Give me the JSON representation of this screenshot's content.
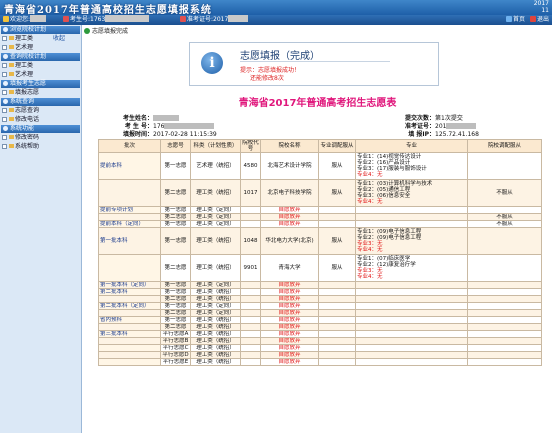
{
  "header": {
    "title": "青海省2017年普通高校招生志愿填报系统",
    "date_line1": "2017",
    "date_line2": "11"
  },
  "topbar": {
    "welcome_label": "欢迎您:",
    "examinee_no_label": "考生号:",
    "examinee_no_value": "1763",
    "admission_no_label": "准考证号:",
    "admission_no_value": "2017",
    "home_label": "首页",
    "exit_label": "退出"
  },
  "sidebar": {
    "groups": [
      {
        "title": "浏览院校计划",
        "items": [
          "理工类",
          "艺术理"
        ],
        "tag": "收起"
      },
      {
        "title": "查询院校计划",
        "items": [
          "理工类",
          "艺术理"
        ]
      },
      {
        "title": "填报考生志愿",
        "items": [
          "填报志愿"
        ]
      },
      {
        "title": "系统查询",
        "items": [
          "志愿查询",
          "修改电话"
        ]
      },
      {
        "title": "系统功能",
        "items": [
          "修改密码",
          "系统帮助"
        ]
      }
    ]
  },
  "breadcrumb": "志愿填报完成",
  "dialog": {
    "title": "志愿填报（完成）",
    "tip_label": "提示：",
    "tip_text": "志愿填报成功！",
    "tip_sub": "还能修改8次",
    "icon": "info-icon"
  },
  "page_title": "青海省2017年普通高考招生志愿表",
  "student": {
    "name_label": "考生姓名：",
    "name": "",
    "no_label": "考 生 号：",
    "no": "176",
    "time_label": "填报时间：",
    "time": "2017-02-28 11:15:39",
    "times_label": "提交次数：",
    "times": "第1次提交",
    "adm_label": "准考证号：",
    "adm": "201",
    "ip_label": "填 报IP：",
    "ip": "125.72.41.168"
  },
  "table": {
    "headers": [
      "批次",
      "志愿号",
      "科类（计划性质）",
      "院校代号",
      "院校名称",
      "专业调配服从",
      "专业",
      "院校调配服从"
    ],
    "rows": [
      {
        "batch": "提前本科",
        "vol": "第一志愿",
        "cat": "艺术理（统招）",
        "code": "4580",
        "school": "北海艺术设计学院",
        "obey": "服从",
        "majors": [
          "专业1：(14)视觉传达设计",
          "专业2：(16)产品设计",
          "专业3：(17)服装与服饰设计",
          "专业4：无"
        ],
        "sobey": ""
      },
      {
        "batch": "",
        "vol": "第二志愿",
        "cat": "理工类（统招）",
        "code": "1017",
        "school": "北京电子科技学院",
        "obey": "服从",
        "majors": [
          "专业1：(03)计算机科学与技术",
          "专业2：(05)通信工程",
          "专业3：(06)信息安全",
          "专业4：无"
        ],
        "sobey": "不服从"
      },
      {
        "batch": "提前专项计划",
        "vol": "第一志愿",
        "cat": "理工类（定向）",
        "code": "",
        "school": "自愿放弃",
        "obey": "",
        "majors": [],
        "sobey": ""
      },
      {
        "batch": "",
        "vol": "第二志愿",
        "cat": "理工类（定向）",
        "code": "",
        "school": "自愿放弃",
        "obey": "",
        "majors": [],
        "sobey": "不服从"
      },
      {
        "batch": "提前本科（定向）",
        "vol": "第一志愿",
        "cat": "理工类（定向）",
        "code": "",
        "school": "自愿放弃",
        "obey": "",
        "majors": [],
        "sobey": "不服从"
      },
      {
        "batch": "第一批本科",
        "vol": "第一志愿",
        "cat": "理工类（统招）",
        "code": "1048",
        "school": "华北电力大学(北京)",
        "obey": "服从",
        "majors": [
          "专业1：(09)电子信息工程",
          "专业2：(09)电子信息工程",
          "专业3：无",
          "专业4：无"
        ],
        "sobey": ""
      },
      {
        "batch": "",
        "vol": "第二志愿",
        "cat": "理工类（统招）",
        "code": "9901",
        "school": "青海大学",
        "obey": "服从",
        "majors": [
          "专业1：(07)临床医学",
          "专业2：(12)康复治疗学",
          "专业3：无",
          "专业4：无"
        ],
        "sobey": ""
      },
      {
        "batch": "第一批本科（定向）",
        "vol": "第一志愿",
        "cat": "理工类（定向）",
        "code": "",
        "school": "自愿放弃",
        "obey": "",
        "majors": [],
        "sobey": ""
      },
      {
        "batch": "第二批本科",
        "vol": "第一志愿",
        "cat": "理工类（统招）",
        "code": "",
        "school": "自愿放弃",
        "obey": "",
        "majors": [],
        "sobey": ""
      },
      {
        "batch": "",
        "vol": "第二志愿",
        "cat": "理工类（统招）",
        "code": "",
        "school": "自愿放弃",
        "obey": "",
        "majors": [],
        "sobey": ""
      },
      {
        "batch": "第二批本科（定向）",
        "vol": "第一志愿",
        "cat": "理工类（定向）",
        "code": "",
        "school": "自愿放弃",
        "obey": "",
        "majors": [],
        "sobey": ""
      },
      {
        "batch": "",
        "vol": "第二志愿",
        "cat": "理工类（定向）",
        "code": "",
        "school": "自愿放弃",
        "obey": "",
        "majors": [],
        "sobey": ""
      },
      {
        "batch": "省内预科",
        "vol": "第一志愿",
        "cat": "理工类（统招）",
        "code": "",
        "school": "自愿放弃",
        "obey": "",
        "majors": [],
        "sobey": ""
      },
      {
        "batch": "",
        "vol": "第二志愿",
        "cat": "理工类（统招）",
        "code": "",
        "school": "自愿放弃",
        "obey": "",
        "majors": [],
        "sobey": ""
      },
      {
        "batch": "第三批本科",
        "vol": "平行志愿A",
        "cat": "理工类（统招）",
        "code": "",
        "school": "自愿放弃",
        "obey": "",
        "majors": [],
        "sobey": ""
      },
      {
        "batch": "",
        "vol": "平行志愿B",
        "cat": "理工类（统招）",
        "code": "",
        "school": "自愿放弃",
        "obey": "",
        "majors": [],
        "sobey": ""
      },
      {
        "batch": "",
        "vol": "平行志愿C",
        "cat": "理工类（统招）",
        "code": "",
        "school": "自愿放弃",
        "obey": "",
        "majors": [],
        "sobey": ""
      },
      {
        "batch": "",
        "vol": "平行志愿D",
        "cat": "理工类（统招）",
        "code": "",
        "school": "自愿放弃",
        "obey": "",
        "majors": [],
        "sobey": ""
      },
      {
        "batch": "",
        "vol": "平行志愿E",
        "cat": "理工类（统招）",
        "code": "",
        "school": "自愿放弃",
        "obey": "",
        "majors": [],
        "sobey": ""
      }
    ]
  }
}
